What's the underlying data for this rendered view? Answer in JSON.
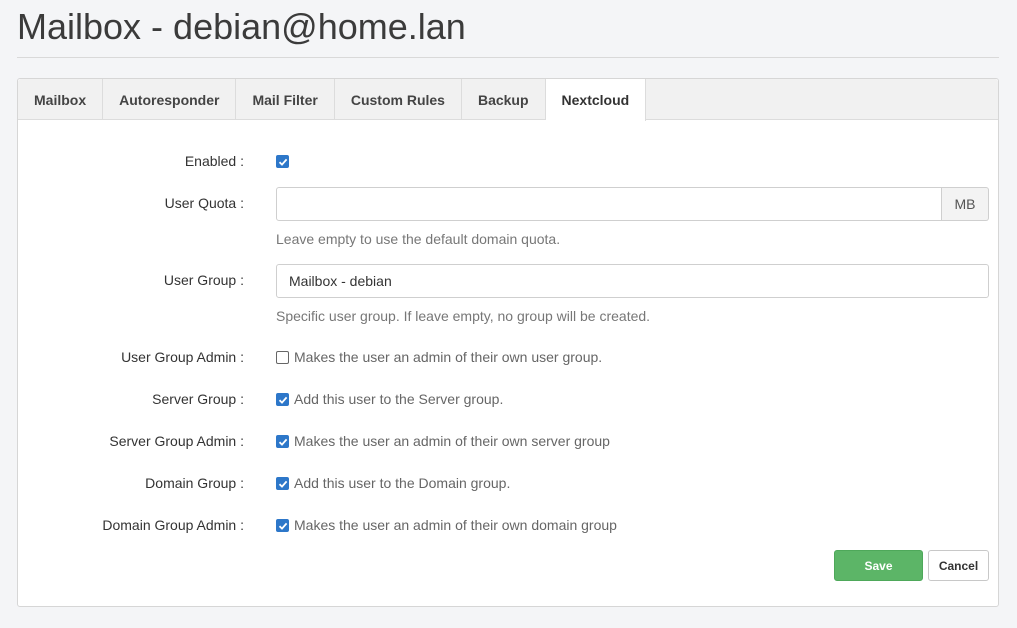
{
  "page": {
    "title": "Mailbox - debian@home.lan"
  },
  "tabs": [
    {
      "label": "Mailbox",
      "active": false
    },
    {
      "label": "Autoresponder",
      "active": false
    },
    {
      "label": "Mail Filter",
      "active": false
    },
    {
      "label": "Custom Rules",
      "active": false
    },
    {
      "label": "Backup",
      "active": false
    },
    {
      "label": "Nextcloud",
      "active": true
    }
  ],
  "form": {
    "enabled": {
      "label": "Enabled :",
      "checked": true
    },
    "user_quota": {
      "label": "User Quota :",
      "value": "",
      "placeholder": "",
      "unit": "MB",
      "help": "Leave empty to use the default domain quota."
    },
    "user_group": {
      "label": "User Group :",
      "value": "Mailbox - debian",
      "help": "Specific user group. If leave empty, no group will be created."
    },
    "user_group_admin": {
      "label": "User Group Admin :",
      "checked": false,
      "text": "Makes the user an admin of their own user group."
    },
    "server_group": {
      "label": "Server Group :",
      "checked": true,
      "text": "Add this user to the Server group."
    },
    "server_group_admin": {
      "label": "Server Group Admin :",
      "checked": true,
      "text": "Makes the user an admin of their own server group"
    },
    "domain_group": {
      "label": "Domain Group :",
      "checked": true,
      "text": "Add this user to the Domain group."
    },
    "domain_group_admin": {
      "label": "Domain Group Admin :",
      "checked": true,
      "text": "Makes the user an admin of their own domain group"
    }
  },
  "buttons": {
    "save": "Save",
    "cancel": "Cancel"
  },
  "colors": {
    "accent": "#2d77c9",
    "save": "#5cb567"
  }
}
